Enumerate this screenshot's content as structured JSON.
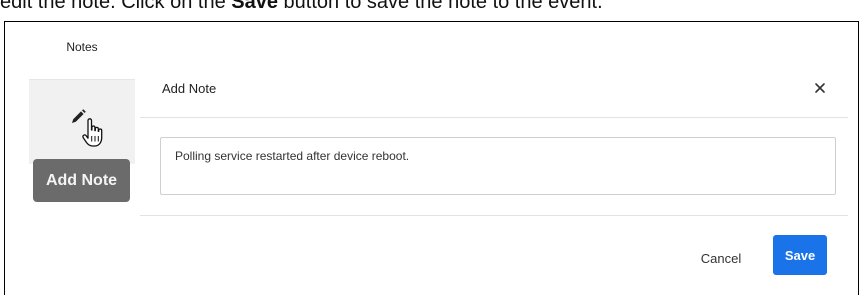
{
  "instruction": {
    "part1": "edit the note. Click on the ",
    "bold": "Save",
    "part2": " button to save the note to the event."
  },
  "notes_panel": {
    "header": "Notes",
    "edit_icon": "pencil-icon",
    "cursor_icon": "hand-pointer-icon",
    "tooltip": "Add Note"
  },
  "dialog": {
    "title": "Add Note",
    "close_icon": "close-icon",
    "note_value": "Polling service restarted after device reboot.",
    "cancel_label": "Cancel",
    "save_label": "Save"
  },
  "colors": {
    "save_button": "#1a73e8",
    "tooltip_bg": "#6b6b6b",
    "edit_cell_bg": "#f1f1f1"
  }
}
